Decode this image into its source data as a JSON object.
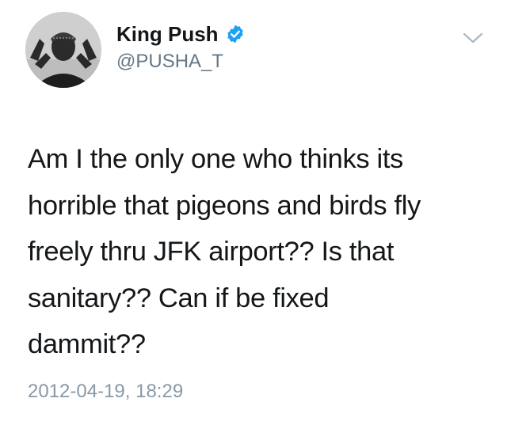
{
  "tweet": {
    "display_name": "King Push",
    "handle": "@PUSHA_T",
    "text": "Am I the only one who thinks its\nhorrible that pigeons and birds fly\nfreely thru JFK airport?? Is that\nsanitary?? Can if be fixed\ndammit??",
    "timestamp": "2012-04-19, 18:29",
    "verified": true
  },
  "icons": {
    "avatar": "avatar-image",
    "verified": "verified-badge-icon",
    "menu": "chevron-down-icon"
  },
  "colors": {
    "verified_blue": "#1da1f2",
    "text_primary": "#14171a",
    "text_secondary": "#657786",
    "timestamp": "#8899a6",
    "chevron": "#aab8c2"
  }
}
